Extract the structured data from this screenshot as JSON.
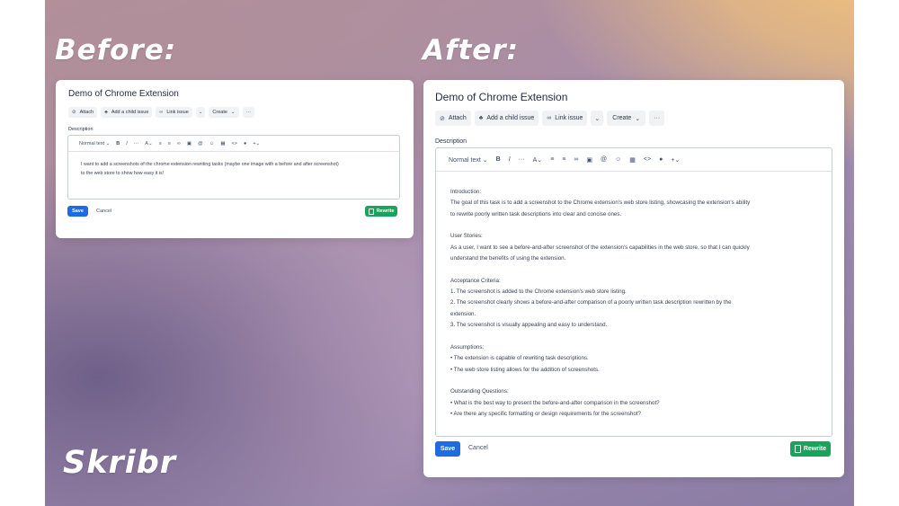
{
  "labels": {
    "before": "Before:",
    "after": "After:",
    "brand": "Skribr"
  },
  "before": {
    "title": "Demo of Chrome Extension",
    "toolbar": {
      "attach": "Attach",
      "add_child": "Add a child issue",
      "link_issue": "Link issue",
      "create": "Create"
    },
    "description_label": "Description",
    "editor": {
      "text_style": "Normal text",
      "lines": [
        "I want to add a screenshots of the chrome extension rewriting tasks (maybe one image with a before and after screenshot)",
        "to the web store to show how easy it is!"
      ]
    },
    "save": "Save",
    "cancel": "Cancel",
    "rewrite": "Rewrite"
  },
  "after": {
    "title": "Demo of Chrome Extension",
    "toolbar": {
      "attach": "Attach",
      "add_child": "Add a child issue",
      "link_issue": "Link issue",
      "create": "Create"
    },
    "description_label": "Description",
    "editor": {
      "text_style": "Normal text",
      "lines": [
        "Introduction:",
        "The goal of this task is to add a screenshot to the Chrome extension's web store listing, showcasing the extension's ability",
        "to rewrite poorly written task descriptions into clear and concise ones.",
        "",
        "User Stories:",
        "As a user, I want to see a before-and-after screenshot of the extension's capabilities in the web store, so that I can quickly",
        "understand the benefits of using the extension.",
        "",
        "Acceptance Criteria:",
        "1. The screenshot is added to the Chrome extension's web store listing.",
        "2. The screenshot clearly shows a before-and-after comparison of a poorly written task description rewritten by the",
        "extension.",
        "3. The screenshot is visually appealing and easy to understand.",
        "",
        "Assumptions:",
        "• The extension is capable of rewriting task descriptions.",
        "• The web store listing allows for the addition of screenshots.",
        "",
        "Outstanding Questions:",
        "• What is the best way to present the before-and-after comparison in the screenshot?",
        "• Are there any specific formatting or design requirements for the screenshot?"
      ]
    },
    "save": "Save",
    "cancel": "Cancel",
    "rewrite": "Rewrite"
  },
  "icons": [
    "paperclip-icon",
    "child-issue-icon",
    "link-icon",
    "chevron-down-icon",
    "more-icon",
    "bold-icon",
    "italic-icon",
    "more-formatting-icon",
    "text-color-icon",
    "bullet-list-icon",
    "numbered-list-icon",
    "link-icon",
    "image-icon",
    "mention-icon",
    "emoji-icon",
    "table-icon",
    "code-icon",
    "info-icon",
    "insert-icon",
    "document-icon"
  ],
  "colors": {
    "save": "#1d6ce0",
    "rewrite": "#1aa35c",
    "title": "#1f2a44"
  }
}
